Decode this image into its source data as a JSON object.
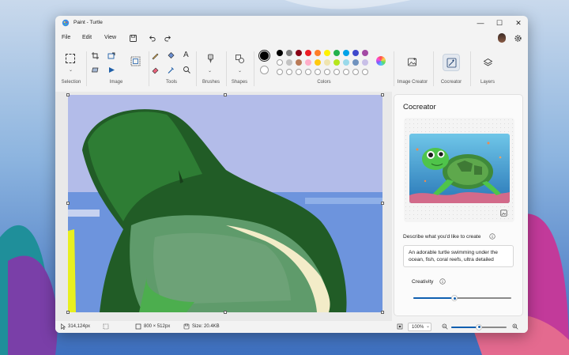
{
  "window": {
    "title": "Paint - Turtle",
    "minimize_glyph": "—",
    "maximize_glyph": "☐",
    "close_glyph": "✕"
  },
  "menu": {
    "items": [
      "File",
      "Edit",
      "View"
    ]
  },
  "ribbon": {
    "groups": {
      "selection": "Selection",
      "image": "Image",
      "tools": "Tools",
      "brushes": "Brushes",
      "shapes": "Shapes",
      "colors": "Colors",
      "image_creator": "Image Creator",
      "cocreator": "Cocreator",
      "layers": "Layers"
    },
    "tool_text_glyph": "A",
    "palette_row1": [
      "#000000",
      "#7f7f7f",
      "#880015",
      "#ed1c24",
      "#ff7f27",
      "#fff200",
      "#22b14c",
      "#00a2e8",
      "#3f48cc",
      "#a349a4"
    ],
    "palette_row2": [
      "#ffffff",
      "#c3c3c3",
      "#b97a57",
      "#ffaec9",
      "#ffc90e",
      "#efe4b0",
      "#b5e61d",
      "#99d9ea",
      "#7092be",
      "#c8bfe7"
    ],
    "palette_row3_empty_count": 10,
    "primary_color": "#000000",
    "secondary_color": "#ffffff"
  },
  "cocreator": {
    "title": "Cocreator",
    "describe_label": "Describe what you'd like to create",
    "prompt_text": "An adorable turtle swimming under the ocean, fish, coral reefs, ultra detailed",
    "creativity_label": "Creativity",
    "creativity_level": 0.42
  },
  "status": {
    "cursor_pos": "314,124px",
    "canvas_size": "800 × 512px",
    "file_size": "Size: 20.4KB",
    "zoom": "100%",
    "zoom_slider_level": 0.5
  },
  "colors": {
    "accent": "#0f5fb0",
    "window_bg": "#f3f3f3"
  }
}
